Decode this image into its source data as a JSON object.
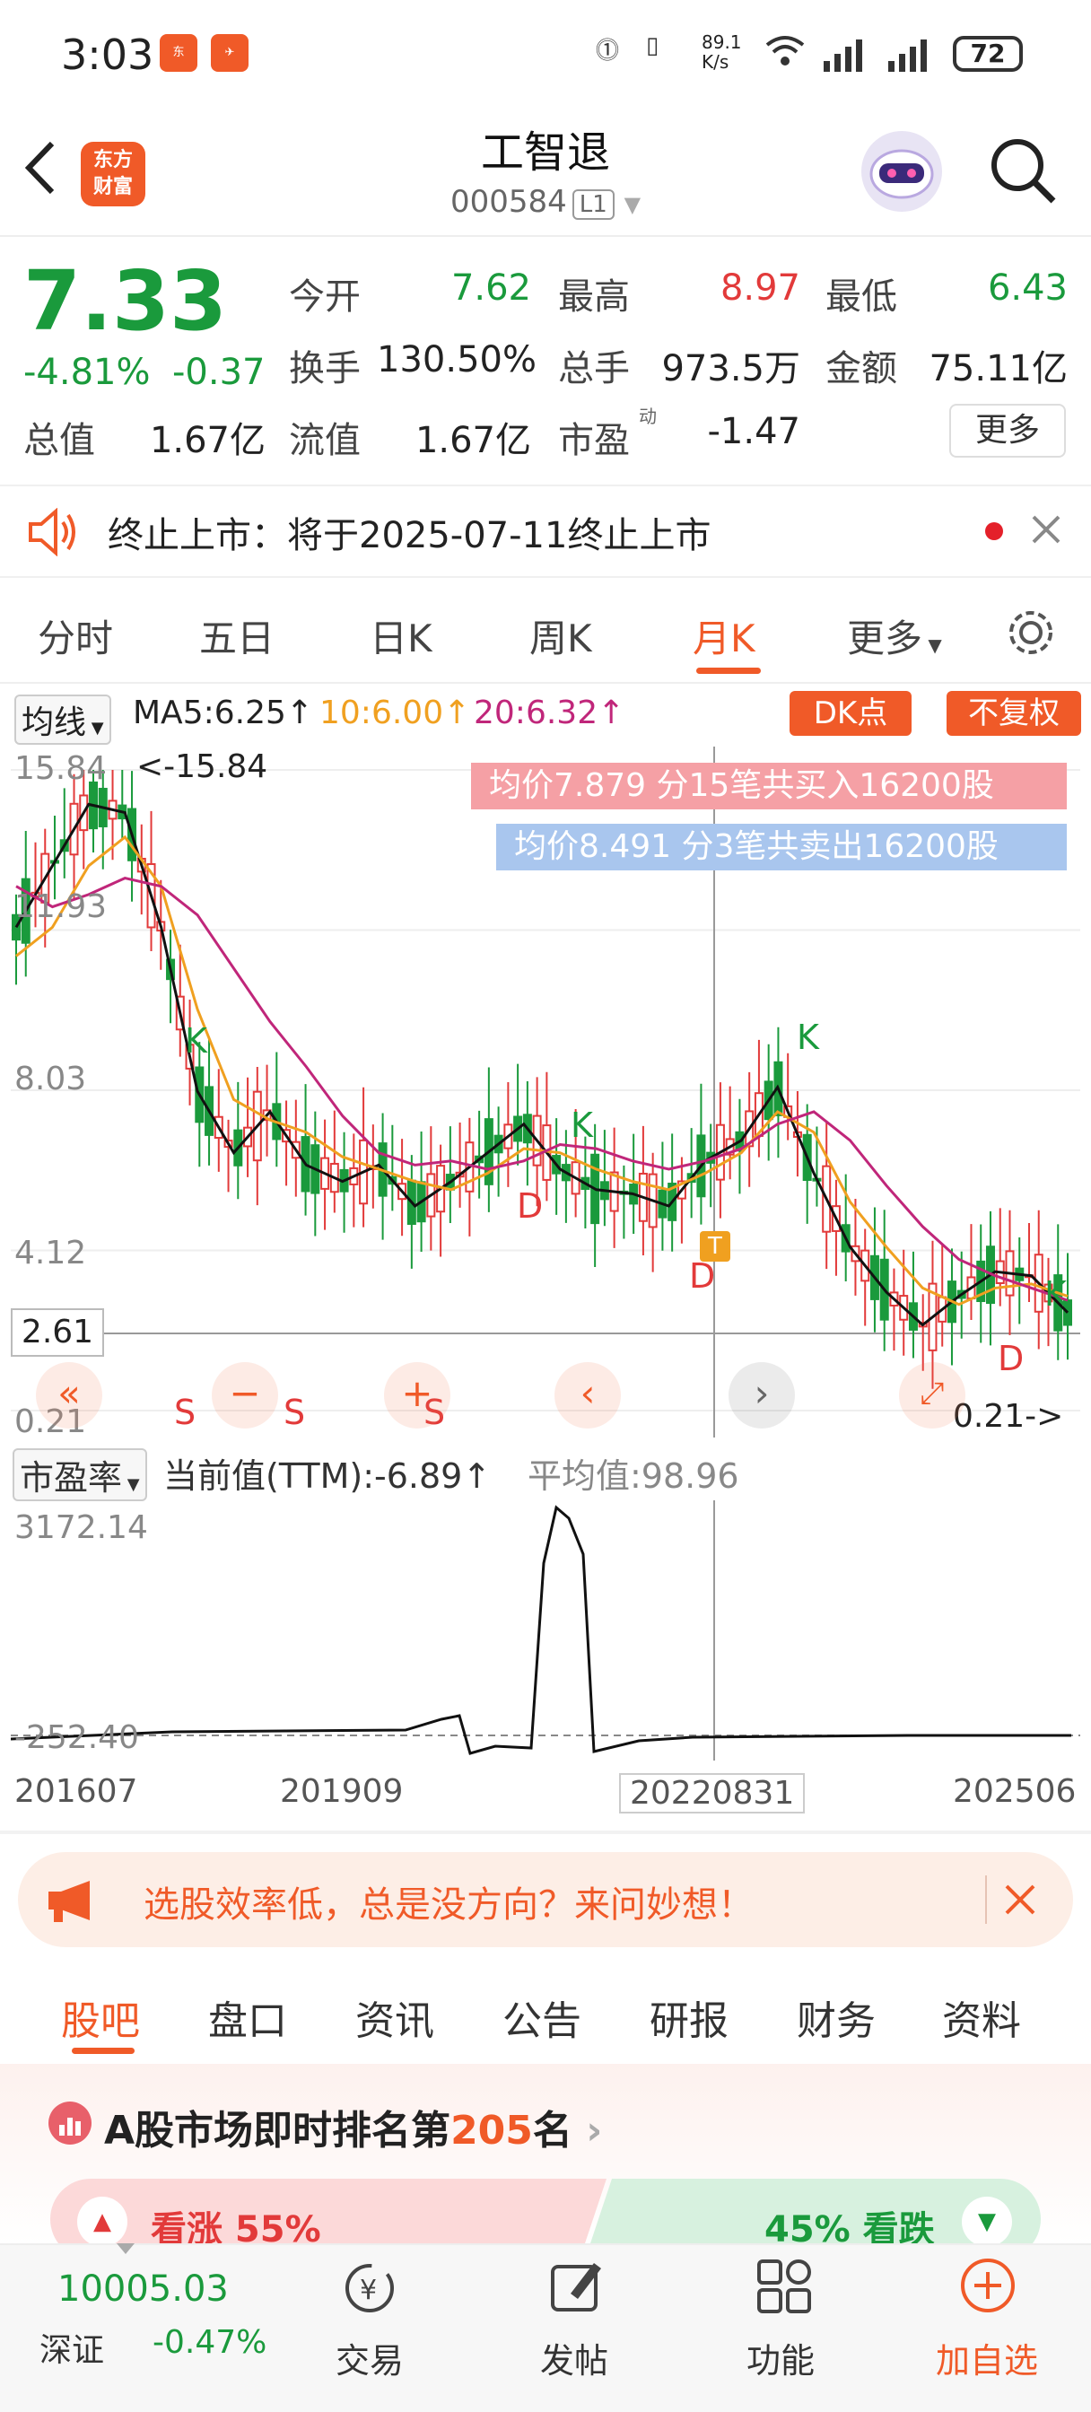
{
  "status_bar": {
    "time": "3:03",
    "net_speed": "89.1\nK/s",
    "battery": "72"
  },
  "header": {
    "back": "<",
    "logo": "东方\n财富",
    "title": "工智退",
    "code": "000584",
    "level": "L1"
  },
  "quote": {
    "price": "7.33",
    "change_pct": "-4.81%",
    "change_abs": "-0.37",
    "open_label": "今开",
    "open": "7.62",
    "high_label": "最高",
    "high": "8.97",
    "low_label": "最低",
    "low": "6.43",
    "turnover_label": "换手",
    "turnover": "130.50%",
    "volume_label": "总手",
    "volume": "973.5万",
    "amount_label": "金额",
    "amount": "75.11亿",
    "mktcap_label": "总值",
    "mktcap": "1.67亿",
    "float_label": "流值",
    "float": "1.67亿",
    "pe_label": "市盈",
    "pe_sup": "动",
    "pe": "-1.47",
    "more": "更多"
  },
  "notice": {
    "text": "终止上市：将于2025-07-11终止上市"
  },
  "kline_tabs": [
    "分时",
    "五日",
    "日K",
    "周K",
    "月K",
    "更多"
  ],
  "kline_active": 4,
  "chart": {
    "indicator": "均线",
    "ma5": "MA5:6.25↑",
    "ma10": "10:6.00↑",
    "ma20": "20:6.32↑",
    "dk": "DK点",
    "fq": "不复权",
    "buy_info": "均价7.879  分15笔共买入16200股",
    "sell_info": "均价8.491  分3笔共卖出16200股",
    "y_labels": [
      "15.84",
      "11.93",
      "8.03",
      "4.12",
      "0.21"
    ],
    "max_label": "<-15.84",
    "min_label": "0.21->",
    "cross_price": "2.61",
    "marks": {
      "K": "K",
      "D": "D",
      "S": "S",
      "T": "T"
    },
    "colors": {
      "up": "#e23a3a",
      "down": "#1a9a3c",
      "ma5": "#111111",
      "ma10": "#f0a020",
      "ma20": "#c0267a"
    }
  },
  "chart_data": {
    "type": "line",
    "title": "",
    "series": [
      {
        "name": "MA5",
        "values": [
          12,
          13.5,
          15,
          14.8,
          12,
          8,
          6.5,
          7.5,
          6.2,
          5.8,
          6.2,
          5.2,
          5.8,
          6.5,
          7.2,
          6.1,
          5.6,
          5.5,
          5.2,
          6.3,
          6.8,
          8.1,
          6,
          4.2,
          3.1,
          2.3,
          3,
          3.6,
          3.5,
          2.6
        ]
      },
      {
        "name": "10",
        "values": [
          11.3,
          12,
          13.5,
          14.2,
          13,
          10,
          7.8,
          7.3,
          7,
          6.4,
          6.1,
          5.8,
          5.6,
          6,
          6.6,
          6.5,
          6.1,
          5.8,
          5.6,
          6,
          6.5,
          7.5,
          7,
          5.3,
          4.2,
          3.2,
          2.8,
          3.2,
          3.3,
          3
        ]
      },
      {
        "name": "20",
        "values": [
          13,
          12.5,
          12.8,
          13.2,
          13,
          12.3,
          11,
          9.7,
          8.6,
          7.4,
          6.5,
          6.2,
          6.3,
          6.1,
          6.3,
          6.7,
          6.6,
          6.3,
          6.1,
          6.3,
          6.6,
          7.2,
          7.5,
          6.8,
          5.7,
          4.7,
          3.9,
          3.5,
          3.2,
          2.9
        ]
      }
    ],
    "ylim": [
      0.21,
      15.84
    ]
  },
  "pe_panel": {
    "selector": "市盈率",
    "current": "当前值(TTM):-6.89↑",
    "avg": "平均值:98.96",
    "max_label": "3172.14",
    "min_label": "-252.40",
    "x_labels": [
      "201607",
      "201909",
      "20220831",
      "202506"
    ]
  },
  "promo": {
    "text": "选股效率低，总是没方向？来问妙想！"
  },
  "bottom_tabs": [
    "股吧",
    "盘口",
    "资讯",
    "公告",
    "研报",
    "财务",
    "资料"
  ],
  "rank": {
    "prefix": "A股市场即时排名第",
    "num": "205",
    "suffix": "名"
  },
  "vote": {
    "up": "看涨 55%",
    "down": "45% 看跌"
  },
  "nav": {
    "index_value": "10005.03",
    "index_name": "深证",
    "index_change": "-0.47%",
    "items": [
      "交易",
      "发帖",
      "功能",
      "加自选"
    ]
  }
}
